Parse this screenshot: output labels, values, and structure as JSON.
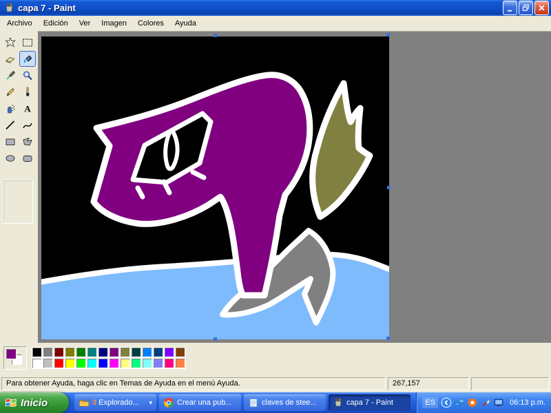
{
  "window": {
    "title": "capa 7 - Paint"
  },
  "menu": {
    "items": [
      "Archivo",
      "Edición",
      "Ver",
      "Imagen",
      "Colores",
      "Ayuda"
    ]
  },
  "toolbox": {
    "selected": "fill",
    "tools": [
      "freeform-select",
      "select",
      "eraser",
      "fill",
      "picker",
      "magnifier",
      "pencil",
      "brush",
      "airbrush",
      "text",
      "line",
      "curve",
      "rectangle",
      "polygon",
      "ellipse",
      "rounded-rectangle"
    ]
  },
  "canvas": {
    "colors": {
      "background": "#000000",
      "figure": "#800080",
      "flame": "#808040",
      "shoe": "#808080",
      "water": "#7EBBFC",
      "outline": "#FFFFFF"
    },
    "handle_color": "#3B6FD6"
  },
  "palette": {
    "foreground": "#800080",
    "background_color": "#FFFFFF",
    "row1": [
      "#000000",
      "#808080",
      "#800000",
      "#808000",
      "#008000",
      "#008080",
      "#000080",
      "#800080",
      "#808040",
      "#004040",
      "#0080FF",
      "#004080",
      "#8000FF",
      "#804000"
    ],
    "row2": [
      "#FFFFFF",
      "#C0C0C0",
      "#FF0000",
      "#FFFF00",
      "#00FF00",
      "#00FFFF",
      "#0000FF",
      "#FF00FF",
      "#FFFF80",
      "#00FF80",
      "#80FFFF",
      "#8080FF",
      "#FF0080",
      "#FF8040"
    ]
  },
  "statusbar": {
    "help": "Para obtener Ayuda, haga clic en Temas de Ayuda en el menú Ayuda.",
    "coordinates": "267,157"
  },
  "taskbar": {
    "start": "Inicio",
    "buttons": [
      {
        "icon": "folder",
        "count": "3",
        "label": "Explorado...",
        "arrow": "▾",
        "active": false
      },
      {
        "icon": "chrome",
        "count": "",
        "label": "Crear una pub...",
        "arrow": "",
        "active": false
      },
      {
        "icon": "notepad",
        "count": "",
        "label": "claves de stee...",
        "arrow": "",
        "active": false
      },
      {
        "icon": "paint",
        "count": "",
        "label": "capa 7 - Paint",
        "arrow": "",
        "active": true
      }
    ],
    "tray": {
      "language": "ES",
      "icons": [
        "hide-icons",
        "network",
        "update",
        "cleaner",
        "display"
      ],
      "clock": "06:13 p.m."
    }
  }
}
